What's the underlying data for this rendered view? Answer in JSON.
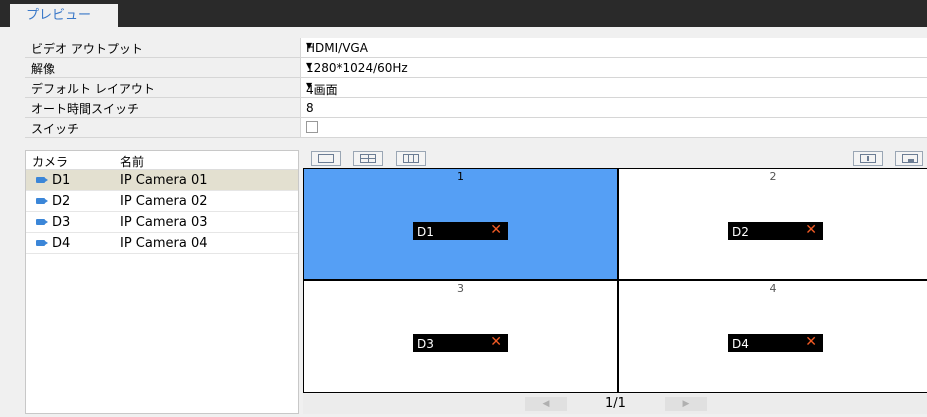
{
  "tab": {
    "label": "プレビュー"
  },
  "settings": {
    "video_output": {
      "label": "ビデオ アウトプット",
      "value": "HDMI/VGA"
    },
    "resolution": {
      "label": "解像",
      "value": "1280*1024/60Hz"
    },
    "default_layout": {
      "label": "デフォルト レイアウト",
      "value": "4画面"
    },
    "auto_switch_time": {
      "label": "オート時間スイッチ",
      "value": "8"
    },
    "switch": {
      "label": "スイッチ",
      "checked": false
    }
  },
  "camera_list": {
    "headers": {
      "camera": "カメラ",
      "name": "名前"
    },
    "items": [
      {
        "id": "D1",
        "name": "IP Camera 01",
        "selected": true
      },
      {
        "id": "D2",
        "name": "IP Camera 02",
        "selected": false
      },
      {
        "id": "D3",
        "name": "IP Camera 03",
        "selected": false
      },
      {
        "id": "D4",
        "name": "IP Camera 04",
        "selected": false
      }
    ]
  },
  "preview_grid": {
    "windows": [
      {
        "number": "1",
        "camera": "D1",
        "active": true
      },
      {
        "number": "2",
        "camera": "D2",
        "active": false
      },
      {
        "number": "3",
        "camera": "D3",
        "active": false
      },
      {
        "number": "4",
        "camera": "D4",
        "active": false
      }
    ]
  },
  "pager": {
    "page": "1/1"
  },
  "colors": {
    "accent": "#3a78c8",
    "active_window": "#559ff5",
    "close": "#f15a24",
    "topbar": "#2a2a2a"
  }
}
